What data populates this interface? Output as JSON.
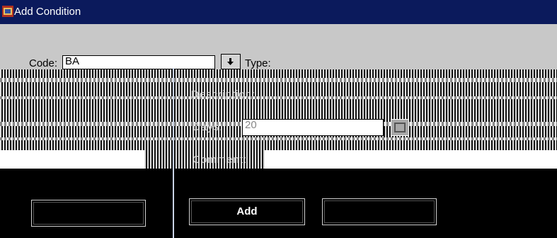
{
  "window": {
    "title": "Add Condition"
  },
  "form": {
    "code_label": "Code:",
    "code_value": "BA",
    "type_label": "Type:",
    "description_label": "Description:",
    "days_label": "Days:",
    "days_value": "20",
    "comment_label": "Comment:",
    "comment_value": ""
  },
  "buttons": {
    "left_label": "",
    "add_label": "Add",
    "right_label": ""
  },
  "colors": {
    "titlebar": "#0b1a5c",
    "form_background": "#c8c8c8",
    "lower_background": "#000000"
  }
}
